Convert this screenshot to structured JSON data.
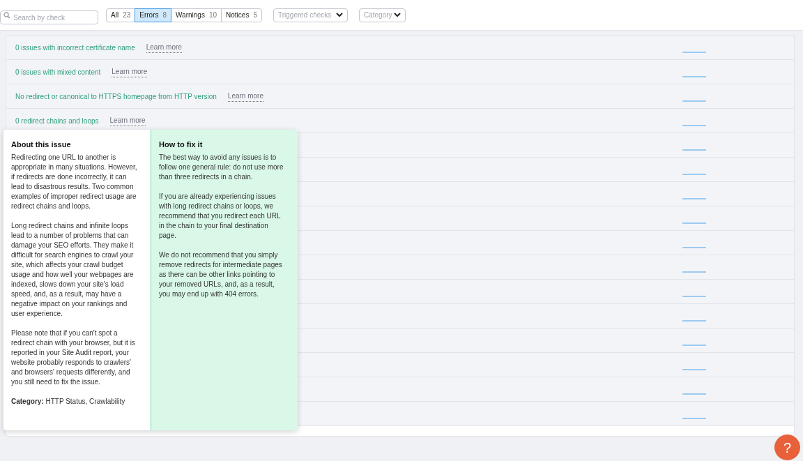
{
  "toolbar": {
    "search": {
      "placeholder": "Search by check"
    },
    "filters": [
      {
        "label": "All",
        "count": "23",
        "selected": false
      },
      {
        "label": "Errors",
        "count": "8",
        "selected": true
      },
      {
        "label": "Warnings",
        "count": "10",
        "selected": false
      },
      {
        "label": "Notices",
        "count": "5",
        "selected": false
      }
    ],
    "dropdowns": [
      {
        "placeholder": "Triggered checks"
      },
      {
        "placeholder": "Category"
      }
    ]
  },
  "rows": [
    {
      "kind": "issue",
      "title": "0 issues with incorrect certificate name",
      "link": "Learn more"
    },
    {
      "kind": "issue",
      "title": "0 issues with mixed content",
      "link": "Learn more"
    },
    {
      "kind": "issue",
      "title": "No redirect or canonical to HTTPS homepage from HTTP version",
      "link": "Learn more"
    },
    {
      "kind": "issue",
      "title": "0 redirect chains and loops",
      "link": "Learn more"
    },
    {
      "kind": "covered"
    },
    {
      "kind": "covered"
    },
    {
      "kind": "covered"
    },
    {
      "kind": "covered"
    },
    {
      "kind": "covered"
    },
    {
      "kind": "covered"
    },
    {
      "kind": "covered"
    },
    {
      "kind": "covered"
    },
    {
      "kind": "covered"
    },
    {
      "kind": "covered"
    },
    {
      "kind": "covered"
    },
    {
      "kind": "covered"
    }
  ],
  "popup": {
    "about": {
      "title": "About this issue",
      "paragraphs": [
        "Redirecting one URL to another is appropriate in many situations. However, if redirects are done incorrectly, it can lead to disastrous results. Two common examples of improper redirect usage are redirect chains and loops.",
        "Long redirect chains and infinite loops lead to a number of problems that can damage your SEO efforts. They make it difficult for search engines to crawl your site, which affects your crawl budget usage and how well your webpages are indexed, slows down your site's load speed, and, as a result, may have a negative impact on your rankings and user experience.",
        "Please note that if you can't spot a redirect chain with your browser, but it is reported in your Site Audit report, your website probably responds to crawlers' and browsers' requests differently, and you still need to fix the issue."
      ],
      "category": "**Category:** HTTP Status, Crawlability"
    },
    "fix": {
      "title": "How to fix it",
      "paragraphs": [
        "The best way to avoid any issues is to follow one general rule: do not use more than three redirects in a chain.",
        "If you are already experiencing issues with long redirect chains or loops, we recommend that you redirect each URL in the chain to your final destination page.",
        "We do not recommend that you simply remove redirects for intermediate pages as there can be other links pointing to your removed URLs, and, as a result, you may end up with 404 errors."
      ]
    }
  },
  "help_button": {
    "label": "?"
  }
}
